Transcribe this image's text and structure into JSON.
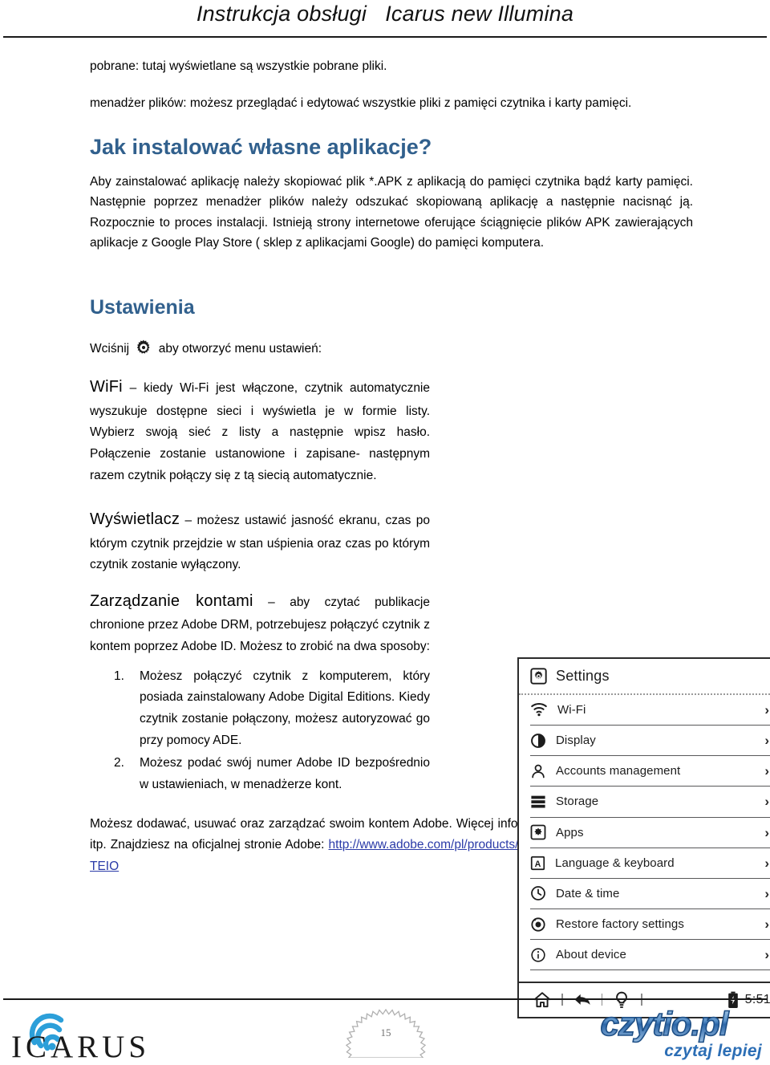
{
  "header": {
    "title": "Instrukcja obsługi   Icarus new Illumina"
  },
  "content": {
    "intro_line1": "pobrane: tutaj wyświetlane są wszystkie pobrane pliki.",
    "intro_line2": "menadżer plików: możesz przeglądać i edytować wszystkie pliki z pamięci czytnika i karty pamięci.",
    "heading_install": "Jak instalować własne aplikacje?",
    "install_para": "Aby zainstalować aplikację należy skopiować plik *.APK z aplikacją do pamięci czytnika bądź karty pamięci. Następnie poprzez menadżer plików należy odszukać skopiowaną aplikację a następnie nacisnąć ją. Rozpocznie to proces instalacji. Istnieją strony internetowe oferujące ściągnięcie plików APK zawierających aplikacje z Google Play Store ( sklep z aplikacjami Google) do pamięci komputera.",
    "heading_settings": "Ustawienia",
    "press_prefix": "Wciśnij",
    "press_suffix": "aby otworzyć menu ustawień:",
    "wifi_term": "WiFi",
    "wifi_body": " – kiedy Wi-Fi jest włączone, czytnik automatycznie wyszukuje dostępne sieci i wyświetla je w formie listy. Wybierz swoją sieć z listy a następnie wpisz hasło. Połączenie zostanie ustanowione i zapisane- następnym razem czytnik połączy się z tą siecią automatycznie.",
    "display_term": "Wyświetlacz",
    "display_body": " – możesz ustawić jasność ekranu, czas po którym czytnik przejdzie w stan uśpienia oraz czas po którym czytnik zostanie wyłączony.",
    "accounts_term": "Zarządzanie kontami",
    "accounts_body": " – aby czytać publikacje chronione przez Adobe DRM, potrzebujesz połączyć czytnik z kontem poprzez Adobe ID. Możesz to zrobić na dwa sposoby:",
    "list_items": [
      "Możesz połączyć czytnik z komputerem, który posiada zainstalowany Adobe Digital Editions. Kiedy czytnik zostanie połączony, możesz autoryzować go przy pomocy ADE.",
      "Możesz podać swój numer Adobe ID bezpośrednio w ustawieniach, w menadżerze kont."
    ],
    "closing_text": "Możesz dodawać, usuwać oraz zarządzać swoim kontem Adobe. Więcej informacji o Adobe DRM, Adobe ID itp. Znajdziesz na oficjalnej stronie Adobe: ",
    "closing_link": "http://www.adobe.com/pl/products/digital-editions.html?promoid=DTEIO"
  },
  "device_panel": {
    "title": "Settings",
    "rows": [
      {
        "label": "Wi-Fi",
        "icon": "wifi-icon",
        "chevron": "›"
      },
      {
        "label": "Display",
        "icon": "display-icon",
        "chevron": "›"
      },
      {
        "label": "Accounts management",
        "icon": "account-icon",
        "chevron": "›"
      },
      {
        "label": "Storage",
        "icon": "storage-icon",
        "chevron": "›"
      },
      {
        "label": "Apps",
        "icon": "apps-icon",
        "chevron": "›"
      },
      {
        "label": "Language & keyboard",
        "icon": "language-icon",
        "chevron": "›"
      },
      {
        "label": "Date & time",
        "icon": "clock-icon",
        "chevron": "›"
      },
      {
        "label": "Restore factory settings",
        "icon": "restore-icon",
        "chevron": "›"
      },
      {
        "label": "About device",
        "icon": "info-icon",
        "chevron": "›"
      }
    ],
    "navbar": {
      "home_icon": "home-icon",
      "back_icon": "back-arrow-icon",
      "light_icon": "lightbulb-icon",
      "battery_icon": "battery-icon",
      "time": "5:51"
    }
  },
  "footer": {
    "brand_left": "ICARUS",
    "page_number": "15",
    "brand_right": "czytio.pl",
    "brand_right_tagline": "czytaj lepiej"
  },
  "colors": {
    "heading_blue": "#31608D",
    "link_blue": "#2B3BA8",
    "logo_blue": "#2C9FD9",
    "czytio_blue": "#2C6EB5"
  }
}
